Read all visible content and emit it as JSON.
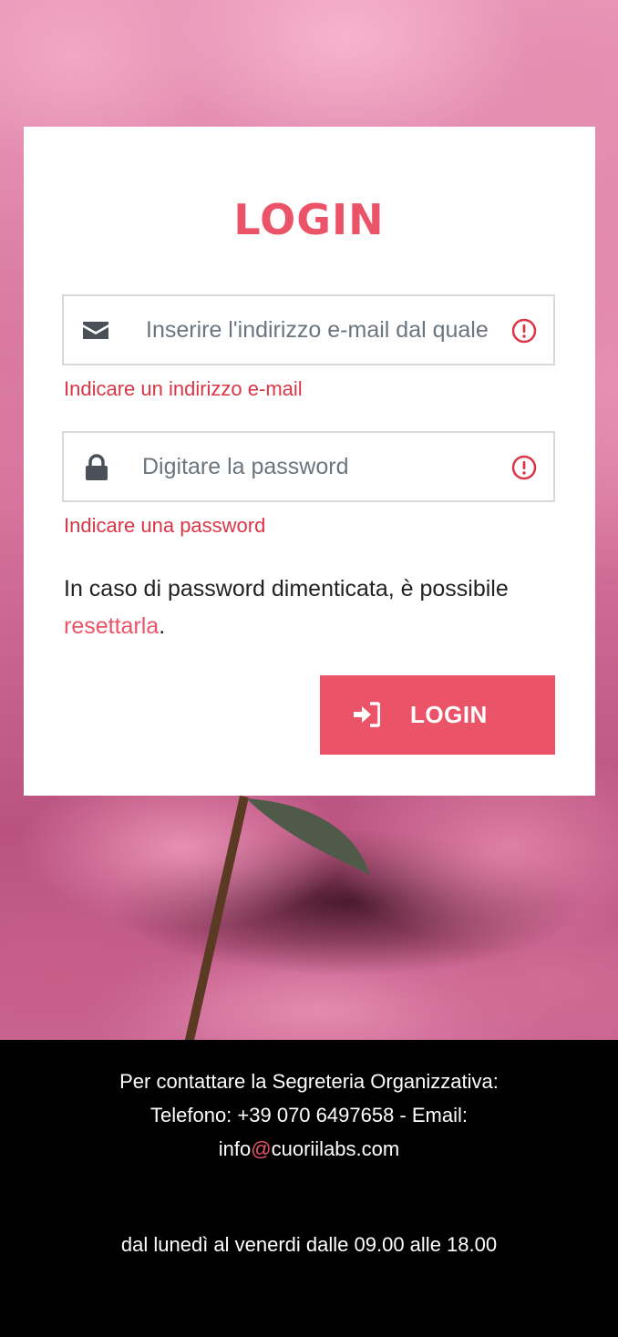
{
  "login": {
    "title": "LOGIN",
    "email_placeholder": "Inserire l'indirizzo e-mail dal quale",
    "email_value": "",
    "email_error": "Indicare un indirizzo e-mail",
    "password_placeholder": "Digitare la password",
    "password_value": "",
    "password_error": "Indicare una password",
    "reset_prefix": "In caso di password dimenticata, è possibile ",
    "reset_link": "resettarla",
    "reset_suffix": ".",
    "button_label": "LOGIN"
  },
  "footer": {
    "line1": "Per contattare la Segreteria Organizzativa:",
    "line2": "Telefono: +39 070 6497658 - Email:",
    "email_user": "info",
    "email_at": "@",
    "email_domain": "cuoriilabs.com",
    "hours": "dal lunedì al venerdi dalle 09.00 alle 18.00"
  },
  "colors": {
    "accent": "#eb5468",
    "error": "#dc3545",
    "footer_bg": "#000000"
  },
  "icons": {
    "email": "envelope-icon",
    "password": "lock-icon",
    "error": "exclamation-circle-icon",
    "login": "sign-in-icon"
  }
}
